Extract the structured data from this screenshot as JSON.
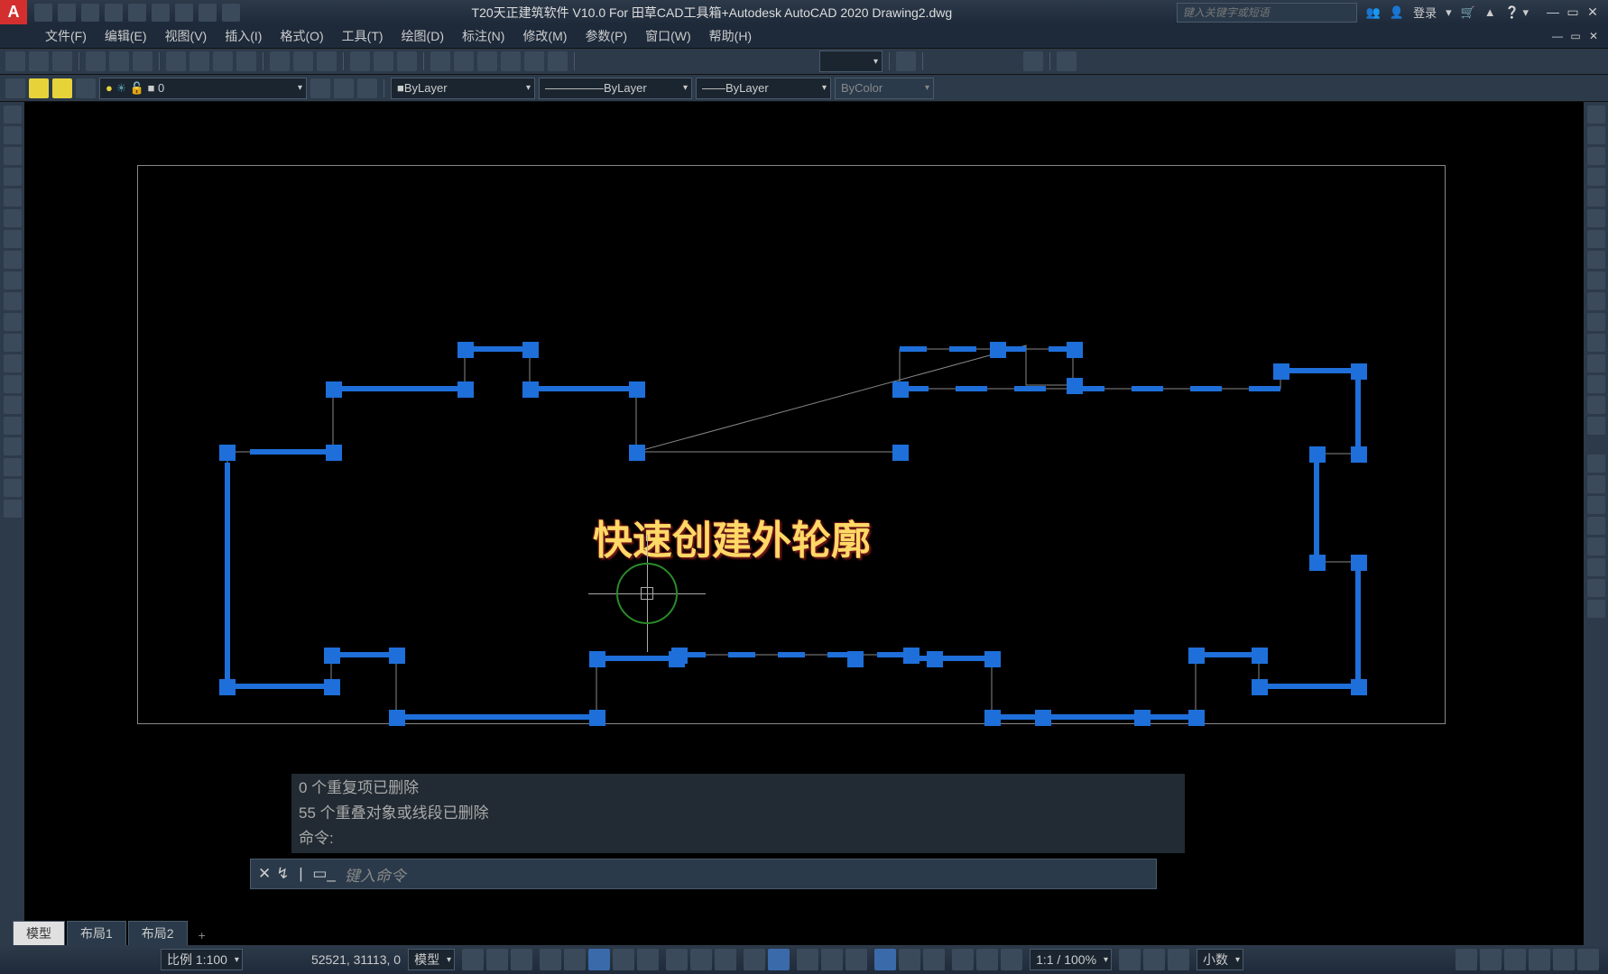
{
  "title": "T20天正建筑软件 V10.0 For 田草CAD工具箱+Autodesk AutoCAD 2020   Drawing2.dwg",
  "search_placeholder": "键入关键字或短语",
  "login_label": "登录",
  "menu": [
    "文件(F)",
    "编辑(E)",
    "视图(V)",
    "插入(I)",
    "格式(O)",
    "工具(T)",
    "绘图(D)",
    "标注(N)",
    "修改(M)",
    "参数(P)",
    "窗口(W)",
    "帮助(H)"
  ],
  "layer_dropdown": "0",
  "prop_color": "ByLayer",
  "prop_linetype": "ByLayer",
  "prop_lineweight": "ByLayer",
  "prop_plotstyle": "ByColor",
  "overlay": "快速创建外轮廓",
  "cmd_history": [
    "0  个重复项已删除",
    "55  个重叠对象或线段已删除",
    "命令:"
  ],
  "cmd_placeholder": "键入命令",
  "tabs": {
    "active": "模型",
    "others": [
      "布局1",
      "布局2"
    ]
  },
  "status": {
    "scale_label": "比例 1:100",
    "coords": "52521, 31113, 0",
    "space": "模型",
    "zoom": "1:1 / 100%",
    "precision": "小数"
  }
}
